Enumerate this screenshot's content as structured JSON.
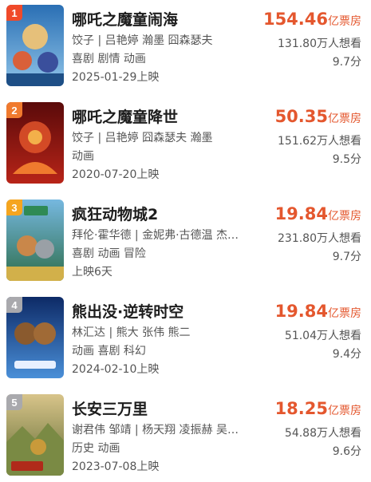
{
  "movies": [
    {
      "rank": "1",
      "title": "哪吒之魔童闹海",
      "cast": "饺子 | 吕艳婷 瀚墨 囧森瑟夫",
      "genre": "喜剧 剧情 动画",
      "release": "2025-01-29上映",
      "box_office": "154.46",
      "box_unit": "亿票房",
      "want": "131.80万人想看",
      "score": "9.7分",
      "poster_colors": [
        "#3a86c8",
        "#c9a35a"
      ]
    },
    {
      "rank": "2",
      "title": "哪吒之魔童降世",
      "cast": "饺子 | 吕艳婷 囧森瑟夫 瀚墨",
      "genre": "动画",
      "release": "2020-07-20上映",
      "box_office": "50.35",
      "box_unit": "亿票房",
      "want": "151.62万人想看",
      "score": "9.5分",
      "poster_colors": [
        "#8b1414",
        "#e0532a"
      ]
    },
    {
      "rank": "3",
      "title": "疯狂动物城2",
      "cast": "拜伦·霍华德 | 金妮弗·古德温 杰…",
      "genre": "喜剧 动画 冒险",
      "release": "上映6天",
      "box_office": "19.84",
      "box_unit": "亿票房",
      "want": "231.80万人想看",
      "score": "9.7分",
      "poster_colors": [
        "#2f8a55",
        "#d2b04a"
      ]
    },
    {
      "rank": "4",
      "title": "熊出没·逆转时空",
      "cast": "林汇达 | 熊大 张伟 熊二",
      "genre": "动画 喜剧 科幻",
      "release": "2024-02-10上映",
      "box_office": "19.84",
      "box_unit": "亿票房",
      "want": "51.04万人想看",
      "score": "9.4分",
      "poster_colors": [
        "#1b3f8a",
        "#5aa0e0"
      ]
    },
    {
      "rank": "5",
      "title": "长安三万里",
      "cast": "谢君伟 邹靖 | 杨天翔 凌振赫 吴…",
      "genre": "历史 动画",
      "release": "2023-07-08上映",
      "box_office": "18.25",
      "box_unit": "亿票房",
      "want": "54.88万人想看",
      "score": "9.6分",
      "poster_colors": [
        "#6a7a3a",
        "#c99a3a"
      ]
    }
  ]
}
